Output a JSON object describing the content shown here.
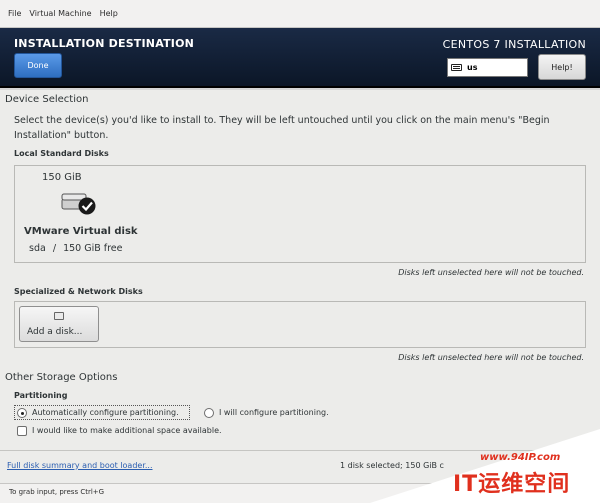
{
  "menu": [
    "File",
    "Virtual Machine",
    "Help"
  ],
  "header": {
    "title": "INSTALLATION DESTINATION",
    "done_label": "Done",
    "product_title": "CENTOS 7 INSTALLATION",
    "keyboard_layout": "us",
    "help_label": "Help!"
  },
  "device_selection": {
    "heading": "Device Selection",
    "description": "Select the device(s) you'd like to install to.  They will be left untouched until you click on the main menu's \"Begin Installation\" button.",
    "local_heading": "Local Standard Disks",
    "disk": {
      "size": "150 GiB",
      "name": "VMware Virtual disk",
      "device": "sda",
      "separator": "/",
      "free": "150 GiB free",
      "selected": true
    },
    "untouched_note": "Disks left unselected here will not be touched.",
    "specialized_heading": "Specialized & Network Disks",
    "add_disk_label": "Add a disk...",
    "untouched_note2": "Disks left unselected here will not be touched."
  },
  "storage_options": {
    "heading": "Other Storage Options",
    "partitioning_heading": "Partitioning",
    "auto_label": "Automatically configure partitioning.",
    "manual_label": "I will configure partitioning.",
    "selected_option": "auto",
    "extra_space_label": "I would like to make additional space available.",
    "extra_space_checked": false
  },
  "footer": {
    "summary_link": "Full disk summary and boot loader...",
    "status": "1 disk selected; 150 GiB c"
  },
  "statusbar": {
    "hint": "To grab input, press Ctrl+G"
  },
  "watermark": {
    "url": "www.94IP.com",
    "brand": "IT运维空间"
  },
  "colors": {
    "header_bg": "#0e1a2e",
    "done_button": "#3c7fd6",
    "link": "#2a5db0",
    "watermark": "#e0301e"
  }
}
